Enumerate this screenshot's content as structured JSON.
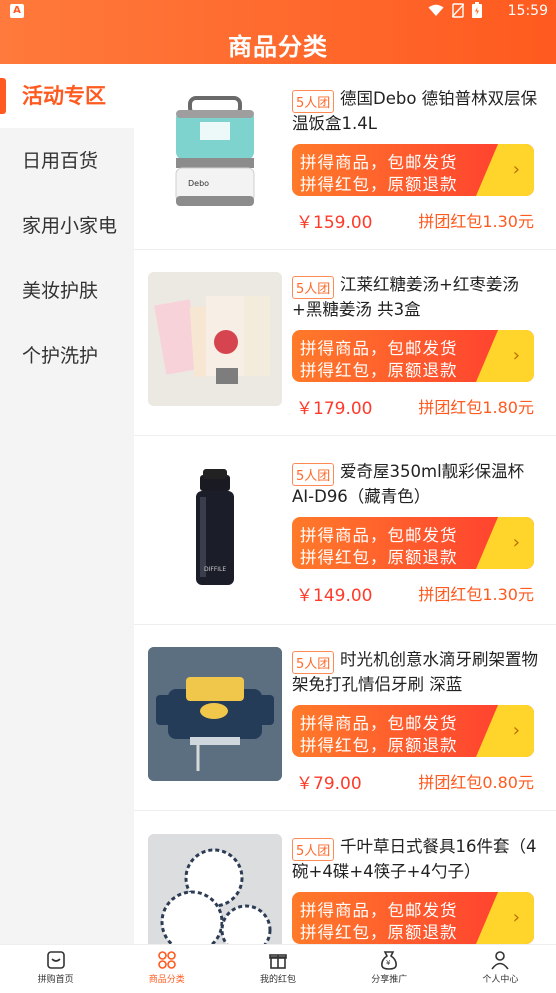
{
  "status_bar": {
    "time": "15:59",
    "left_icon": "A"
  },
  "header": {
    "title": "商品分类"
  },
  "sidebar": {
    "items": [
      {
        "label": "活动专区",
        "active": true
      },
      {
        "label": "日用百货",
        "active": false
      },
      {
        "label": "家用小家电",
        "active": false
      },
      {
        "label": "美妆护肤",
        "active": false
      },
      {
        "label": "个护洗护",
        "active": false
      }
    ]
  },
  "products": [
    {
      "badge": "5人团",
      "name": "德国Debo 德铂普林双层保温饭盒1.4L",
      "promo_line1": "拼得商品，包邮发货",
      "promo_line2": "拼得红包，原额退款",
      "price": "￥159.00",
      "red_packet": "拼团红包1.30元",
      "image": "lunchbox"
    },
    {
      "badge": "5人团",
      "name": "江莱红糖姜汤+红枣姜汤+黑糖姜汤 共3盒",
      "promo_line1": "拼得商品，包邮发货",
      "promo_line2": "拼得红包，原额退款",
      "price": "￥179.00",
      "red_packet": "拼团红包1.80元",
      "image": "tea-boxes"
    },
    {
      "badge": "5人团",
      "name": "爱奇屋350ml靓彩保温杯AI-D96（藏青色）",
      "promo_line1": "拼得商品，包邮发货",
      "promo_line2": "拼得红包，原额退款",
      "price": "￥149.00",
      "red_packet": "拼团红包1.30元",
      "image": "thermos"
    },
    {
      "badge": "5人团",
      "name": "时光机创意水滴牙刷架置物架免打孔情侣牙刷 深蓝",
      "promo_line1": "拼得商品，包邮发货",
      "promo_line2": "拼得红包，原额退款",
      "price": "￥79.00",
      "red_packet": "拼团红包0.80元",
      "image": "toothbrush-holder"
    },
    {
      "badge": "5人团",
      "name": "千叶草日式餐具16件套（4碗+4碟+4筷子+4勺子）",
      "promo_line1": "拼得商品，包邮发货",
      "promo_line2": "拼得红包，原额退款",
      "price": "",
      "red_packet": "",
      "image": "tableware"
    }
  ],
  "bottom_nav": {
    "items": [
      {
        "label": "拼购首页",
        "icon": "home-icon"
      },
      {
        "label": "商品分类",
        "icon": "grid-icon",
        "active": true
      },
      {
        "label": "我的红包",
        "icon": "gift-icon"
      },
      {
        "label": "分享推广",
        "icon": "share-bag-icon"
      },
      {
        "label": "个人中心",
        "icon": "user-icon"
      }
    ]
  },
  "colors": {
    "accent": "#ff5a1f",
    "price": "#ff3a2a",
    "promo_yellow": "#ffd52c"
  }
}
